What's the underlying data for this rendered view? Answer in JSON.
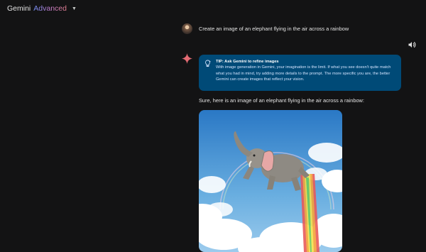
{
  "header": {
    "brand_name": "Gemini",
    "brand_tier": "Advanced",
    "caret_icon": "caret-down-icon"
  },
  "conversation": {
    "user_prompt": "Create an image of an elephant flying in the air across a rainbow",
    "tip": {
      "title": "TIP: Ask Gemini to refine images",
      "body": "With image generation in Gemini, your imagination is the limit. If what you see doesn't quite match what you had in mind, try adding more details to the prompt. The more specific you are, the better Gemini can create images that reflect your vision."
    },
    "response_text": "Sure, here is an image of an elephant flying in the air across a rainbow:"
  },
  "icons": {
    "speaker": "speaker-icon",
    "sparkle": "gemini-sparkle-icon",
    "tip": "lightbulb-icon"
  },
  "colors": {
    "background": "#131314",
    "tip_background": "#004a77",
    "sparkle_accent": "#e36b73"
  }
}
